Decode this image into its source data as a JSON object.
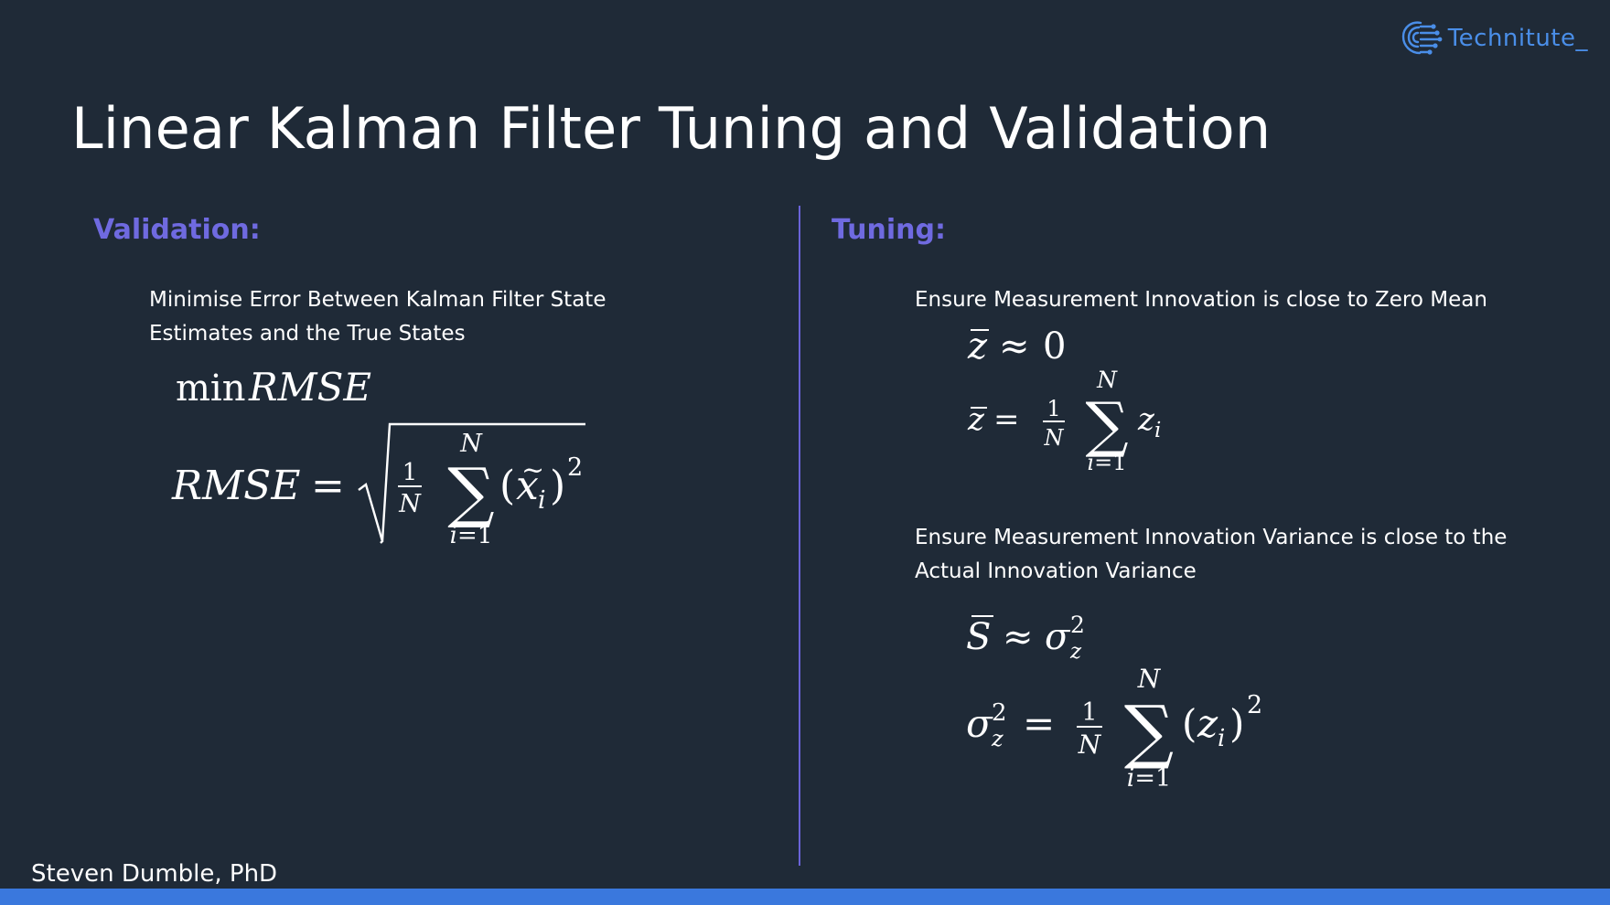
{
  "brand": {
    "name": "Technitute_",
    "icon": "brain-circuit-icon",
    "color": "#4a8ee8"
  },
  "slide": {
    "title": "Linear Kalman Filter Tuning and Validation"
  },
  "validation": {
    "heading": "Validation:",
    "description_line1": "Minimise Error Between Kalman Filter State",
    "description_line2": "Estimates and the True States",
    "eq_min": "min RMSE",
    "eq_rmse": "RMSE = √( 1/N ∑ᵢ₌₁ᴺ (x̃ᵢ)² )"
  },
  "tuning": {
    "heading": "Tuning:",
    "item1": {
      "description": "Ensure Measurement Innovation is close to Zero Mean",
      "eq_approx": "z̄ ≈ 0",
      "eq_def": "z̄ = 1/N ∑ᵢ₌₁ᴺ zᵢ"
    },
    "item2": {
      "description_line1": "Ensure Measurement Innovation Variance is close to the",
      "description_line2": "Actual Innovation Variance",
      "eq_approx": "S̄ ≈ σ_z²",
      "eq_def": "σ_z² = 1/N ∑ᵢ₌₁ᴺ (zᵢ)²"
    }
  },
  "footer": {
    "author": "Steven Dumble, PhD",
    "bar_color": "#3a78dd"
  },
  "colors": {
    "background": "#1f2a37",
    "heading": "#6f6ae0",
    "divider": "#6a63d8"
  }
}
